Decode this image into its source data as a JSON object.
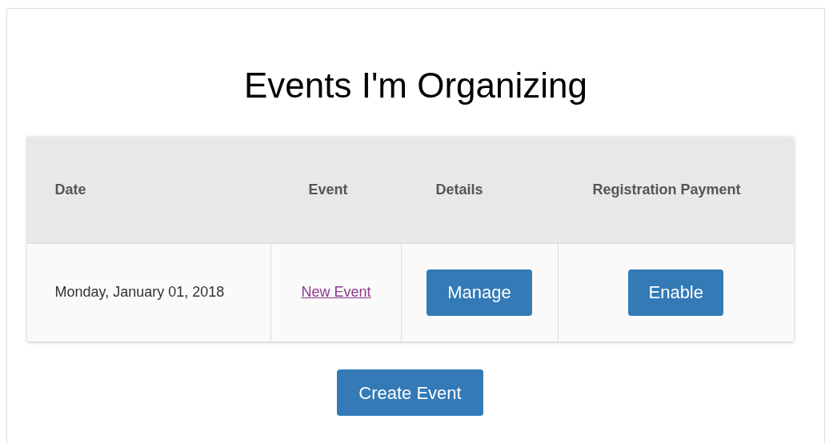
{
  "title": "Events I'm Organizing",
  "table": {
    "columns": [
      "Date",
      "Event",
      "Details",
      "Registration Payment"
    ],
    "rows": [
      {
        "date": "Monday, January 01, 2018",
        "event": "New Event",
        "details_button": "Manage",
        "payment_button": "Enable"
      }
    ]
  },
  "create_button": "Create Event"
}
